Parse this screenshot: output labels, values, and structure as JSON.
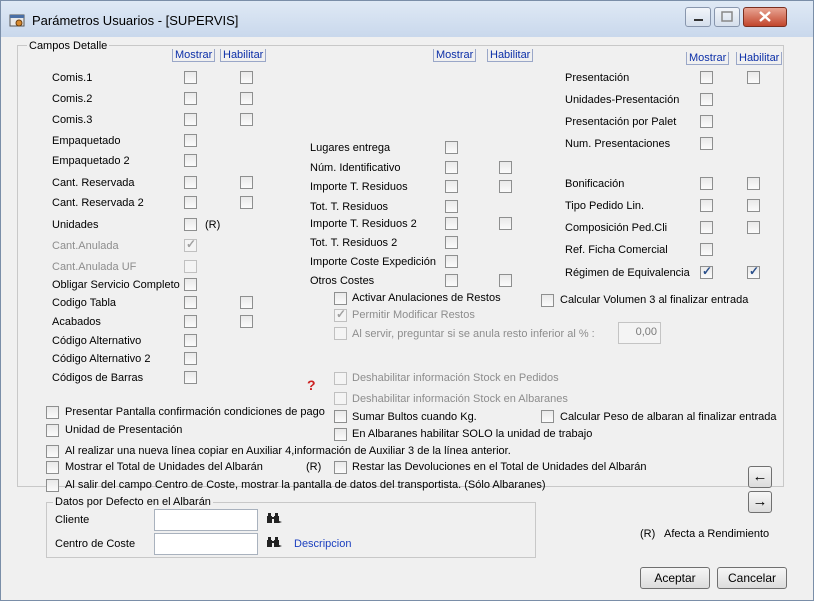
{
  "window": {
    "title": "Parámetros Usuarios - [SUPERVIS]"
  },
  "group_detalle": {
    "title": "Campos Detalle"
  },
  "headers": {
    "mostrar": "Mostrar",
    "habilitar": "Habilitar"
  },
  "col1": [
    {
      "label": "Comis.1",
      "mostrar": false,
      "habilitar": false
    },
    {
      "label": "Comis.2",
      "mostrar": false,
      "habilitar": false
    },
    {
      "label": "Comis.3",
      "mostrar": false,
      "habilitar": false
    },
    {
      "label": "Empaquetado",
      "mostrar": false
    },
    {
      "label": "Empaquetado 2",
      "mostrar": false
    },
    {
      "label": "Cant. Reservada",
      "mostrar": false,
      "habilitar": false
    },
    {
      "label": "Cant. Reservada 2",
      "mostrar": false,
      "habilitar": false
    },
    {
      "label": "Unidades",
      "mostrar": false,
      "suffix": "(R)"
    },
    {
      "label": "Cant.Anulada",
      "mostrar": true,
      "disabled": true
    },
    {
      "label": "Cant.Anulada UF",
      "mostrar": false,
      "disabled": true
    },
    {
      "label": "Obligar Servicio Completo",
      "mostrar": false
    },
    {
      "label": "Codigo Tabla",
      "mostrar": false,
      "habilitar": false
    },
    {
      "label": "Acabados",
      "mostrar": false,
      "habilitar": false
    },
    {
      "label": "Código Alternativo",
      "mostrar": false
    },
    {
      "label": "Código Alternativo 2",
      "mostrar": false
    },
    {
      "label": "Códigos de Barras",
      "mostrar": false
    }
  ],
  "col2": [
    {
      "label": "Lugares entrega",
      "mostrar": false
    },
    {
      "label": "Núm. Identificativo",
      "mostrar": false,
      "habilitar": false
    },
    {
      "label": "Importe T. Residuos",
      "mostrar": false,
      "habilitar": false
    },
    {
      "label": "Tot. T. Residuos",
      "mostrar": false
    },
    {
      "label": "Importe T. Residuos 2",
      "mostrar": false,
      "habilitar": false
    },
    {
      "label": "Tot. T. Residuos 2",
      "mostrar": false
    },
    {
      "label": "Importe Coste Expedición",
      "mostrar": false
    },
    {
      "label": "Otros Costes",
      "mostrar": false,
      "habilitar": false
    }
  ],
  "col3": [
    {
      "label": "Presentación",
      "mostrar": false,
      "habilitar": false
    },
    {
      "label": "Unidades-Presentación",
      "mostrar": false
    },
    {
      "label": "Presentación por Palet",
      "mostrar": false
    },
    {
      "label": "Num. Presentaciones",
      "mostrar": false
    },
    {
      "label": "Bonificación",
      "mostrar": false,
      "habilitar": false
    },
    {
      "label": "Tipo Pedido Lin.",
      "mostrar": false,
      "habilitar": false
    },
    {
      "label": "Composición Ped.Cli",
      "mostrar": false,
      "habilitar": false
    },
    {
      "label": "Ref. Ficha Comercial",
      "mostrar": false
    },
    {
      "label": "Régimen de Equivalencia",
      "mostrar": true,
      "habilitar": true
    }
  ],
  "options": {
    "activar_anulaciones": "Activar Anulaciones de Restos",
    "permitir_modificar": "Permitir Modificar Restos",
    "al_servir": "Al servir, preguntar si se anula resto inferior al % :",
    "al_servir_value": "0,00",
    "calcular_volumen": "Calcular Volumen 3 al finalizar entrada",
    "deshab_pedidos": "Deshabilitar información Stock en Pedidos",
    "deshab_albaranes": "Deshabilitar información Stock en Albaranes",
    "sumar_bultos": "Sumar Bultos cuando Kg.",
    "calcular_peso": "Calcular Peso de albaran al finalizar entrada",
    "en_albaranes": "En Albaranes habilitar SOLO la unidad de trabajo",
    "presentar_pantalla": "Presentar Pantalla confirmación condiciones de pago",
    "unidad_presentacion": "Unidad de Presentación",
    "al_realizar": "Al realizar una nueva línea copiar en Auxiliar 4,información de Auxiliar 3 de la línea anterior.",
    "mostrar_total": "Mostrar el Total de Unidades del Albarán",
    "mostrar_total_r": "(R)",
    "restar_devoluciones": "Restar las Devoluciones en el Total de Unidades del Albarán",
    "al_salir": "Al salir del campo Centro de Coste, mostrar la pantalla de datos del transportista. (Sólo Albaranes)"
  },
  "defaults_group": {
    "title": "Datos por Defecto en el Albarán",
    "cliente_label": "Cliente",
    "cliente_value": "",
    "centro_label": "Centro de Coste",
    "centro_value": "",
    "descripcion": "Descripcion"
  },
  "footer": {
    "legend_r": "(R)",
    "legend_text": "Afecta a Rendimiento",
    "accept": "Aceptar",
    "cancel": "Cancelar"
  }
}
